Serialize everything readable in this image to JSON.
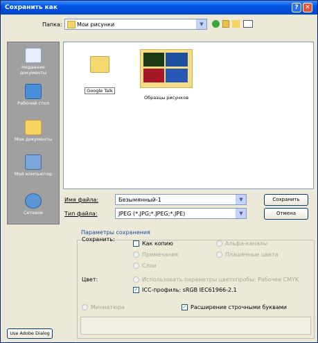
{
  "window": {
    "title": "Сохранить как"
  },
  "toolbar": {
    "folder_label": "Папка:",
    "folder_value": "Мои рисунки"
  },
  "places": [
    {
      "label": "Недавние документы",
      "icon": "recent-documents-icon"
    },
    {
      "label": "Рабочий стол",
      "icon": "desktop-icon"
    },
    {
      "label": "Мои документы",
      "icon": "my-documents-icon"
    },
    {
      "label": "Мой компьютер",
      "icon": "my-computer-icon"
    },
    {
      "label": "Сетевое",
      "icon": "network-icon"
    }
  ],
  "files": [
    {
      "label": "Google Talk",
      "type": "folder"
    },
    {
      "label": "Образцы рисунков",
      "type": "thumbnail-folder"
    }
  ],
  "form": {
    "filename_label": "Имя файла:",
    "filename_value": "Безымянный-1",
    "filetype_label": "Тип файла:",
    "filetype_value": "JPEG (*.JPG;*.JPEG;*.JPE)",
    "save_button": "Сохранить",
    "cancel_button": "Отмена"
  },
  "options": {
    "legend": "Параметры сохранения",
    "save_label": "Сохранить:",
    "as_copy": "Как копию",
    "annotations": "Примечания",
    "alpha": "Альфа-каналы",
    "spot": "Плашечные цвета",
    "layers": "Слои",
    "color_label": "Цвет:",
    "proof": "Использовать параметры цветопробы: Рабочее CMYK",
    "icc": "ICC-профиль:  sRGB IEC61966-2.1",
    "thumbnail": "Миниатюра",
    "lowercase": "Расширение строчными буквами"
  },
  "footer": {
    "adobe_dialog": "Use Adobe Dialog"
  }
}
